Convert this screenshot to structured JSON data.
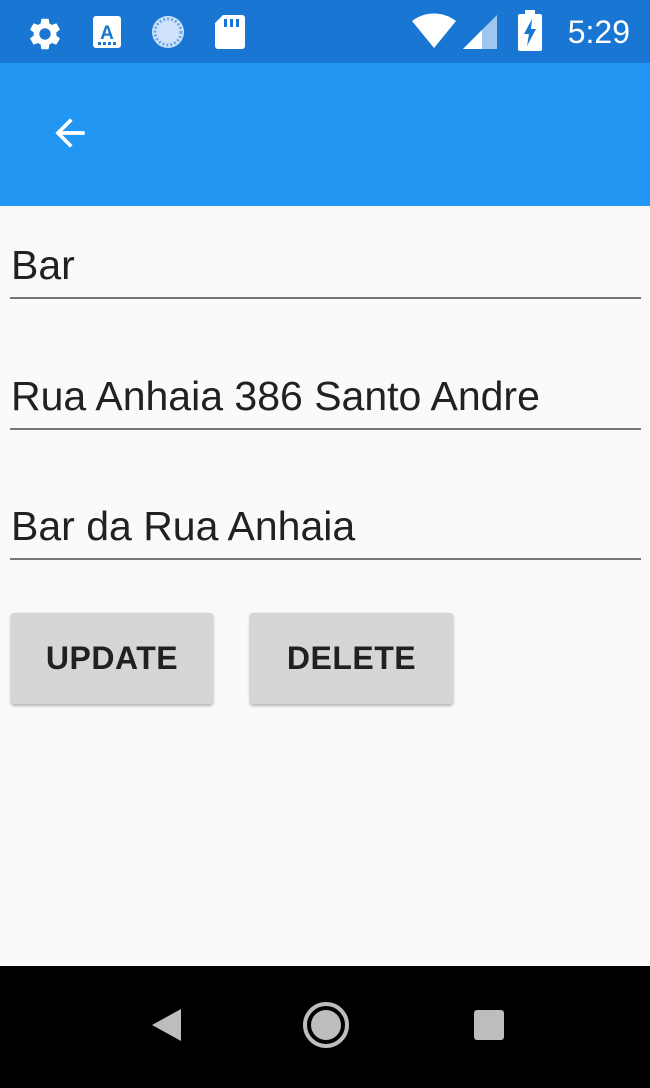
{
  "status_bar": {
    "time": "5:29",
    "icons": [
      "gear-icon",
      "text-a-icon",
      "sync-icon",
      "sd-card-icon",
      "wifi-icon",
      "signal-icon",
      "battery-charging-icon"
    ]
  },
  "app_bar": {
    "back_icon": "arrow-left-icon",
    "color": "#2196f3",
    "status_color": "#1976d2"
  },
  "form": {
    "fields": [
      {
        "value": "Bar"
      },
      {
        "value": "Rua Anhaia 386 Santo Andre"
      },
      {
        "value": "Bar da Rua Anhaia"
      }
    ],
    "update_label": "UPDATE",
    "delete_label": "DELETE"
  },
  "nav_bar": {
    "icons": [
      "back-triangle-icon",
      "home-circle-icon",
      "recents-square-icon"
    ]
  }
}
